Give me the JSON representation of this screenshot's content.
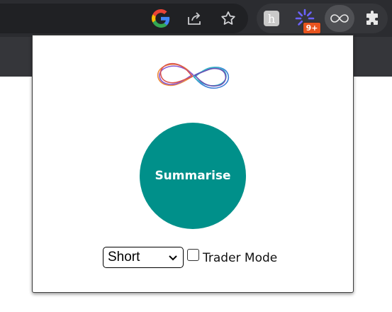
{
  "toolbar": {
    "icons": [
      "google-icon",
      "share-icon",
      "bookmark-star-icon"
    ],
    "extensions": [
      "honey-extension-icon",
      "spinner-extension-icon",
      "infinity-extension-icon",
      "extensions-puzzle-icon"
    ],
    "badge": "9+",
    "colors": {
      "toolbar": "#2b2c30",
      "badge": "#e8541e"
    }
  },
  "popup": {
    "logo": "infinity-logo",
    "summarise_label": "Summarise",
    "length_select": {
      "selected": "Short"
    },
    "trader_mode": {
      "label": "Trader Mode",
      "checked": false
    },
    "colors": {
      "button": "#00908a"
    }
  }
}
